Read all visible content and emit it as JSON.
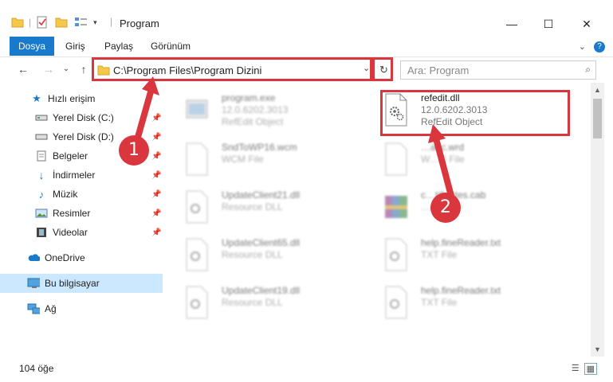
{
  "window": {
    "title": "Program",
    "controls": {
      "minimize": "—",
      "maximize": "☐",
      "close": "✕"
    }
  },
  "ribbon": {
    "tabs": [
      "Dosya",
      "Giriş",
      "Paylaş",
      "Görünüm"
    ],
    "expand_glyph": "⌄",
    "help_glyph": "?"
  },
  "address": {
    "path": "C:\\Program Files\\Program Dizini",
    "dropdown_glyph": "⌄",
    "refresh_glyph": "↻"
  },
  "search": {
    "placeholder": "Ara: Program",
    "icon": "search-icon",
    "glyph": "⌕"
  },
  "nav": {
    "back": "←",
    "forward": "→",
    "recent": "⌄",
    "up": "↑"
  },
  "sidebar": {
    "items": [
      {
        "label": "Hızlı erişim",
        "icon": "star-icon",
        "pinned": false
      },
      {
        "label": "Yerel Disk (C:)",
        "icon": "drive-icon",
        "pinned": true
      },
      {
        "label": "Yerel Disk (D:)",
        "icon": "drive-icon",
        "pinned": true
      },
      {
        "label": "Belgeler",
        "icon": "documents-icon",
        "pinned": true
      },
      {
        "label": "İndirmeler",
        "icon": "downloads-icon",
        "pinned": true
      },
      {
        "label": "Müzik",
        "icon": "music-icon",
        "pinned": true
      },
      {
        "label": "Resimler",
        "icon": "pictures-icon",
        "pinned": true
      },
      {
        "label": "Videolar",
        "icon": "videos-icon",
        "pinned": true
      },
      {
        "label": "OneDrive",
        "icon": "cloud-icon",
        "pinned": false
      },
      {
        "label": "Bu bilgisayar",
        "icon": "computer-icon",
        "pinned": false
      },
      {
        "label": "Ağ",
        "icon": "network-icon",
        "pinned": false
      }
    ]
  },
  "files": [
    {
      "name": "program.exe",
      "line1": "12.0.6202.3013",
      "line2": "RefEdit Object",
      "icon": "exe-icon",
      "blurred": true
    },
    {
      "name": "refedit.dll",
      "line1": "12.0.6202.3013",
      "line2": "RefEdit Object",
      "icon": "dll-gear-icon",
      "blurred": false
    },
    {
      "name": "SndToWP16.wcm",
      "line1": "WCM File",
      "line2": "",
      "icon": "blank-file-icon",
      "blurred": true
    },
    {
      "name": "…abc.wrd",
      "line1": "W…D File",
      "line2": "",
      "icon": "blank-file-icon",
      "blurred": true
    },
    {
      "name": "UpdateClient21.dll",
      "line1": "Resource DLL",
      "line2": "",
      "icon": "dll-gear-icon",
      "blurred": true
    },
    {
      "name": "c…tificates.cab",
      "line1": "…Archive",
      "line2": "",
      "icon": "archive-icon",
      "blurred": true
    },
    {
      "name": "UpdateClient65.dll",
      "line1": "Resource DLL",
      "line2": "",
      "icon": "dll-gear-icon",
      "blurred": true
    },
    {
      "name": "help.fineReader.txt",
      "line1": "TXT File",
      "line2": "",
      "icon": "text-gear-icon",
      "blurred": true
    },
    {
      "name": "UpdateClient19.dll",
      "line1": "Resource DLL",
      "line2": "",
      "icon": "dll-gear-icon",
      "blurred": true
    },
    {
      "name": "help.fineReader.txt",
      "line1": "TXT File",
      "line2": "",
      "icon": "text-gear-icon",
      "blurred": true
    }
  ],
  "status": {
    "count": "104 öğe"
  },
  "annotations": {
    "step1": "1",
    "step2": "2",
    "color": "#d9363e"
  },
  "colors": {
    "accent": "#1979ca",
    "selected": "#cce8ff",
    "highlight": "#d9363e"
  }
}
